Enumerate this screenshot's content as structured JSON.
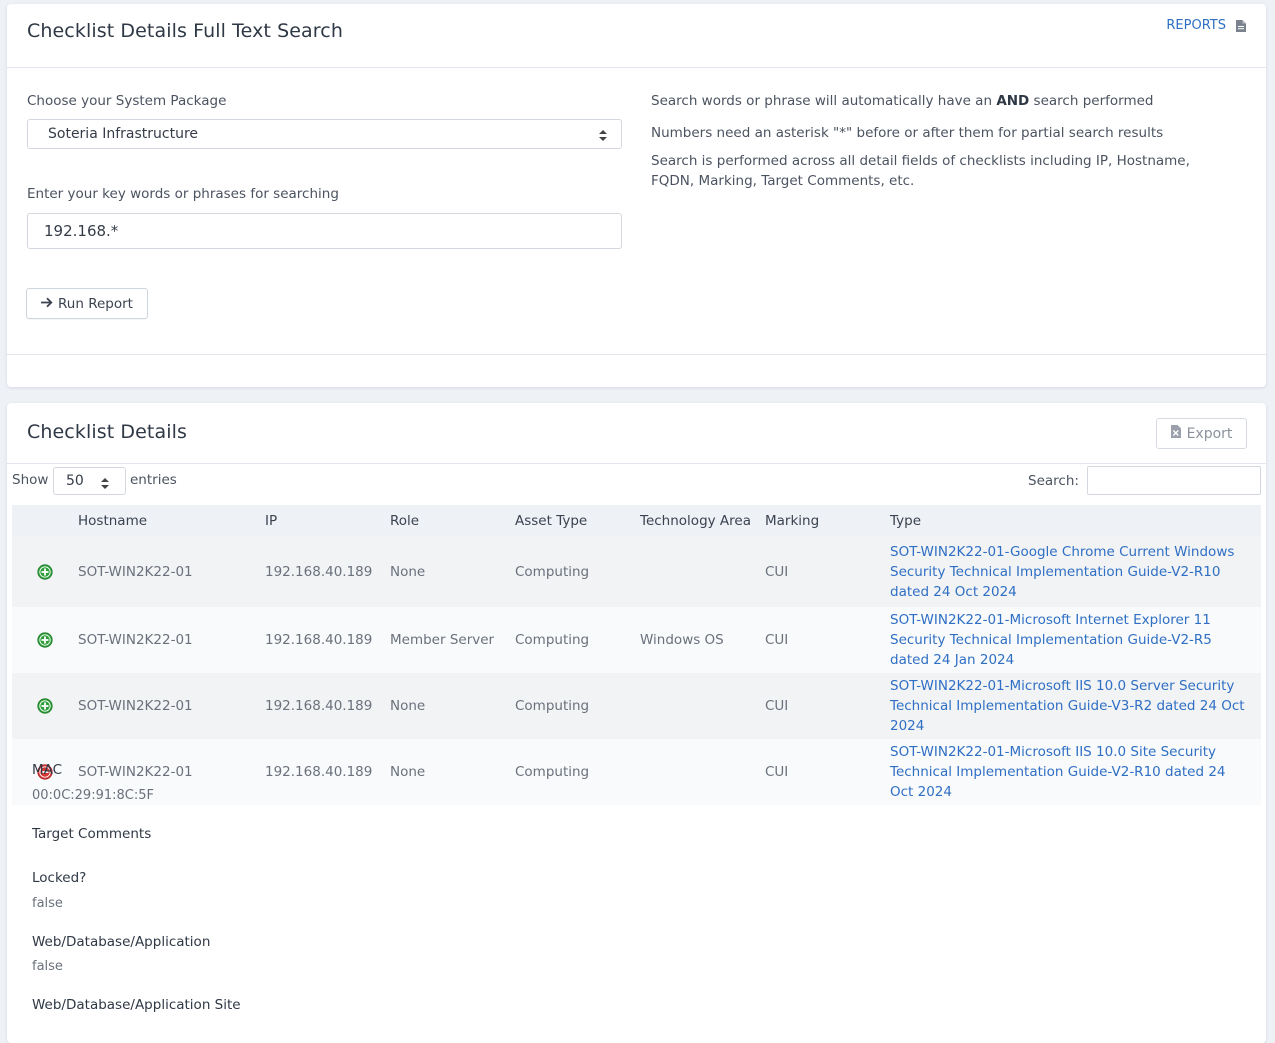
{
  "search_card": {
    "title": "Checklist Details Full Text Search",
    "reports_label": "REPORTS",
    "package_label": "Choose your System Package",
    "package_value": "Soteria Infrastructure",
    "keywords_label": "Enter your key words or phrases for searching",
    "keywords_value": "192.168.*",
    "run_label": "Run Report",
    "help_line1_pre": "Search words or phrase will automatically have an ",
    "help_line1_bold": "AND",
    "help_line1_post": " search performed",
    "help_line2": "Numbers need an asterisk \"*\" before or after them for partial search results",
    "help_line3": "Search is performed across all detail fields of checklists including IP, Hostname, FQDN, Marking, Target Comments, etc."
  },
  "details_card": {
    "title": "Checklist Details",
    "export_label": "Export",
    "show_label": "Show",
    "entries_value": "50",
    "entries_label": "entries",
    "search_label": "Search:",
    "columns": [
      "Hostname",
      "IP",
      "Role",
      "Asset Type",
      "Technology Area",
      "Marking",
      "Type"
    ],
    "rows": [
      {
        "state": "expand",
        "hostname": "SOT-WIN2K22-01",
        "ip": "192.168.40.189",
        "role": "None",
        "asset_type": "Computing",
        "tech_area": "",
        "marking": "CUI",
        "type": "SOT-WIN2K22-01-Google Chrome Current Windows Security Technical Implementation Guide-V2-R10 dated 24 Oct 2024"
      },
      {
        "state": "expand",
        "hostname": "SOT-WIN2K22-01",
        "ip": "192.168.40.189",
        "role": "Member Server",
        "asset_type": "Computing",
        "tech_area": "Windows OS",
        "marking": "CUI",
        "type": "SOT-WIN2K22-01-Microsoft Internet Explorer 11 Security Technical Implementation Guide-V2-R5 dated 24 Jan 2024"
      },
      {
        "state": "expand",
        "hostname": "SOT-WIN2K22-01",
        "ip": "192.168.40.189",
        "role": "None",
        "asset_type": "Computing",
        "tech_area": "",
        "marking": "CUI",
        "type": "SOT-WIN2K22-01-Microsoft IIS 10.0 Server Security Technical Implementation Guide-V3-R2 dated 24 Oct 2024"
      },
      {
        "state": "collapse",
        "hostname": "SOT-WIN2K22-01",
        "ip": "192.168.40.189",
        "role": "None",
        "asset_type": "Computing",
        "tech_area": "",
        "marking": "CUI",
        "type": "SOT-WIN2K22-01-Microsoft IIS 10.0 Site Security Technical Implementation Guide-V2-R10 dated 24 Oct 2024"
      }
    ],
    "detail": {
      "mac_label": "MAC",
      "mac_value": "00:0C:29:91:8C:5F",
      "comments_label": "Target Comments",
      "comments_value": "",
      "locked_label": "Locked?",
      "locked_value": "false",
      "web_label": "Web/Database/Application",
      "web_value": "false",
      "web_site_label": "Web/Database/Application Site"
    }
  },
  "colors": {
    "page_bg": "#eef1f6",
    "link": "#2f6fc4",
    "expand_icon": "#2e9e3a",
    "collapse_icon": "#d63535"
  }
}
